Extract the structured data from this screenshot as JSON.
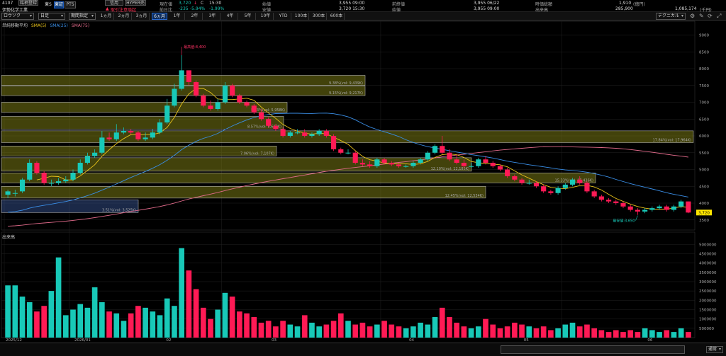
{
  "header": {
    "code": "4107",
    "name": "伊勢化学工業",
    "btn_register": "銘柄登録",
    "market": "東S",
    "btn_tosho": "東証",
    "btn_pts": "PTS",
    "btn_credit": "信用",
    "btn_hyper": "HYPER売",
    "warning": "取引注意喚起",
    "now_label": "現在値",
    "now_value": "3,720",
    "now_arrow": "↓",
    "now_flag": "C",
    "now_time": "15:30",
    "change_label": "前日比",
    "change_value": "-235",
    "change_pct": "-5.94%",
    "change_pct2": "-1.99%",
    "open_label": "始値",
    "open_value": "3,955 09:00",
    "high_label": "高値",
    "high_value": "3,955 09:00",
    "low_label": "安値",
    "low_value": "3,720 15:30",
    "prev_label": "前終値",
    "prev_value": "3,955 06/22",
    "close_label": "始値",
    "close_value": "3,955 09:00",
    "mcap_label": "時価総額",
    "mcap_value": "1,910",
    "mcap_unit": "(億円)",
    "vol_label": "出来高",
    "vol_value": "285,900",
    "turnover_value": "1,085,174",
    "turnover_unit": "(千円)"
  },
  "toolbar": {
    "chart_type": "ロウソク",
    "interval": "日足",
    "period_mode": "期間指定",
    "ranges": [
      "1ヵ月",
      "2ヵ月",
      "3ヵ月",
      "6ヵ月",
      "1年",
      "2年",
      "3年",
      "4年",
      "5年",
      "10年",
      "YTD",
      "100本",
      "300本",
      "600本"
    ],
    "selected_range": "6ヵ月",
    "technical": "テクニカル"
  },
  "legend": {
    "title": "単純移動平均",
    "sma5": "SMA(5)",
    "sma25": "SMA(25)",
    "sma75": "SMA(75)",
    "sma5_color": "#e8c21a",
    "sma25_color": "#3a8ee6",
    "sma75_color": "#e06a8a"
  },
  "volume_panel": {
    "title": "出来高"
  },
  "footer": {
    "mode": "通常"
  },
  "chart_data": [
    {
      "type": "candlestick",
      "name": "price",
      "up_color": "#18c9b8",
      "down_color": "#ff1a55",
      "ylim": [
        3200,
        9200
      ],
      "yticks": [
        3500,
        4000,
        4500,
        5000,
        5500,
        6000,
        6500,
        7000,
        7500,
        8000,
        8500,
        9000
      ],
      "last_price": "3,720",
      "annotations": {
        "high": {
          "label": "最高値:8,400",
          "value": 8400
        },
        "low": {
          "label": "最安値:3,650",
          "value": 3650
        }
      },
      "volume_profile": [
        {
          "label": "9.38%(vol: 9,439K)",
          "lo": 7500,
          "hi": 7800
        },
        {
          "label": "9.15%(vol: 9,217K)",
          "lo": 7200,
          "hi": 7480
        },
        {
          "label": "5.93%(vol: 5,958K)",
          "lo": 6700,
          "hi": 7000
        },
        {
          "label": "8.57%(vol: 8,623K)",
          "lo": 6200,
          "hi": 6580
        },
        {
          "label": "7.06%(vol: 7,107K)",
          "lo": 5400,
          "hi": 5700
        },
        {
          "label": "17.84%(vol: 17,964K)",
          "lo": 5800,
          "hi": 6150
        },
        {
          "label": "12.10%(vol: 12,185K)",
          "lo": 4950,
          "hi": 5350
        },
        {
          "label": "15.33%(vol: 15,436K)",
          "lo": 4600,
          "hi": 4900
        },
        {
          "label": "12.45%(vol: 12,534K)",
          "lo": 4150,
          "hi": 4500
        },
        {
          "label": "3.51%(vol: 3,525K)",
          "lo": 3720,
          "hi": 4100
        }
      ],
      "o": [
        4250,
        4300,
        4350,
        4700,
        5200,
        4900,
        4600,
        4600,
        4650,
        4700,
        4900,
        5200,
        5400,
        5500,
        5950,
        5900,
        6100,
        6150,
        6100,
        5900,
        5950,
        6100,
        6400,
        6900,
        7400,
        7950,
        7600,
        7200,
        6900,
        6800,
        7000,
        7500,
        7200,
        7000,
        6900,
        6700,
        6500,
        6300,
        6200,
        6000,
        6100,
        6100,
        6000,
        6050,
        6150,
        6000,
        5600,
        5500,
        5500,
        5200,
        5150,
        5100,
        5300,
        5200,
        5150,
        5100,
        5100,
        5200,
        5300,
        5500,
        5700,
        5500,
        5300,
        5200,
        5100,
        5100,
        5300,
        5200,
        5100,
        5000,
        4800,
        4700,
        4600,
        4600,
        4500,
        4350,
        4300,
        4450,
        4550,
        4700,
        4600,
        4350,
        4200,
        4100,
        4050,
        4000,
        3900,
        3800,
        3750,
        3800,
        3850,
        3900,
        3800,
        3900,
        4050
      ],
      "c": [
        4350,
        4300,
        4700,
        5200,
        4900,
        4600,
        4600,
        4650,
        4700,
        4900,
        5200,
        5400,
        5500,
        5950,
        5900,
        6100,
        6150,
        6100,
        5900,
        5950,
        6100,
        6400,
        6900,
        7400,
        7950,
        7600,
        7200,
        6900,
        6800,
        7000,
        7500,
        7200,
        7000,
        6900,
        6700,
        6500,
        6300,
        6200,
        6000,
        6100,
        6100,
        6000,
        6050,
        6150,
        6000,
        5600,
        5500,
        5500,
        5200,
        5150,
        5100,
        5300,
        5200,
        5150,
        5100,
        5100,
        5200,
        5300,
        5500,
        5700,
        5500,
        5300,
        5200,
        5100,
        5100,
        5300,
        5200,
        5100,
        5000,
        4800,
        4700,
        4600,
        4600,
        4500,
        4350,
        4300,
        4450,
        4550,
        4700,
        4600,
        4350,
        4200,
        4100,
        4050,
        4000,
        3900,
        3800,
        3750,
        3800,
        3850,
        3900,
        3800,
        3900,
        4050,
        3720
      ],
      "h": [
        4400,
        4400,
        4750,
        5300,
        5250,
        4950,
        4700,
        4750,
        4800,
        5000,
        5300,
        5500,
        5600,
        6150,
        6100,
        6350,
        6250,
        6200,
        6150,
        6100,
        6200,
        6500,
        7100,
        7550,
        8400,
        7800,
        7650,
        7250,
        7050,
        7100,
        7600,
        7550,
        7250,
        7050,
        6950,
        6800,
        6550,
        6350,
        6250,
        6150,
        6200,
        6200,
        6100,
        6200,
        6200,
        6050,
        5650,
        5600,
        5550,
        5300,
        5250,
        5350,
        5350,
        5250,
        5200,
        5150,
        5250,
        5350,
        5550,
        5750,
        6000,
        5600,
        5450,
        5300,
        5200,
        5350,
        5400,
        5250,
        5150,
        5050,
        4850,
        4750,
        4700,
        4650,
        4550,
        4400,
        4500,
        4600,
        4750,
        4800,
        4650,
        4400,
        4250,
        4150,
        4100,
        4050,
        3950,
        3850,
        3850,
        3900,
        3950,
        3950,
        3950,
        4100,
        4050
      ],
      "l": [
        4150,
        4200,
        4300,
        4650,
        4850,
        4550,
        4500,
        4550,
        4600,
        4650,
        4850,
        5150,
        5350,
        5450,
        5850,
        5850,
        6050,
        6050,
        5850,
        5850,
        5900,
        6050,
        6350,
        6850,
        7350,
        7500,
        7150,
        6850,
        6750,
        6750,
        6950,
        7150,
        6950,
        6850,
        6650,
        6450,
        6250,
        6150,
        5950,
        5950,
        6050,
        5950,
        5950,
        6000,
        5950,
        5550,
        5450,
        5450,
        5150,
        5100,
        5050,
        5050,
        5150,
        5100,
        5050,
        5050,
        5050,
        5150,
        5250,
        5450,
        5450,
        5250,
        5150,
        5050,
        5050,
        5050,
        5150,
        5050,
        4950,
        4750,
        4650,
        4550,
        4550,
        4450,
        4300,
        4250,
        4250,
        4400,
        4500,
        4550,
        4300,
        4150,
        4050,
        4000,
        3950,
        3850,
        3750,
        3650,
        3700,
        3750,
        3800,
        3750,
        3750,
        3850,
        3700
      ]
    },
    {
      "type": "bar",
      "name": "volume",
      "ylim": [
        0,
        5200000
      ],
      "yticks": [
        500000,
        1000000,
        1500000,
        2000000,
        2500000,
        3000000,
        3500000,
        4000000,
        4500000,
        5000000
      ],
      "x_labels": [
        "2025/12",
        "2026/01",
        "02",
        "03",
        "04",
        "05",
        "06"
      ],
      "values": [
        2800000,
        2800000,
        2200000,
        1900000,
        1400000,
        1700000,
        2500000,
        4300000,
        1200000,
        1500000,
        1800000,
        1600000,
        2700000,
        1900000,
        1400000,
        1300000,
        900000,
        1300000,
        1700000,
        1600000,
        1400000,
        1200000,
        2100000,
        1700000,
        4800000,
        3600000,
        2600000,
        1600000,
        1000000,
        1500000,
        2400000,
        2200000,
        1400000,
        1300000,
        1100000,
        800000,
        900000,
        600000,
        900000,
        700000,
        600000,
        1200000,
        800000,
        600000,
        700000,
        900000,
        1300000,
        900000,
        700000,
        800000,
        600000,
        700000,
        900000,
        700000,
        600000,
        500000,
        600000,
        800000,
        700000,
        1100000,
        1600000,
        1100000,
        800000,
        600000,
        500000,
        600000,
        1000000,
        700000,
        500000,
        600000,
        800000,
        700000,
        600000,
        500000,
        600000,
        400000,
        500000,
        700000,
        800000,
        600000,
        700000,
        500000,
        400000,
        300000,
        400000,
        300000,
        400000,
        300000,
        500000,
        400000,
        300000,
        400000,
        300000,
        500000,
        300000
      ]
    }
  ]
}
